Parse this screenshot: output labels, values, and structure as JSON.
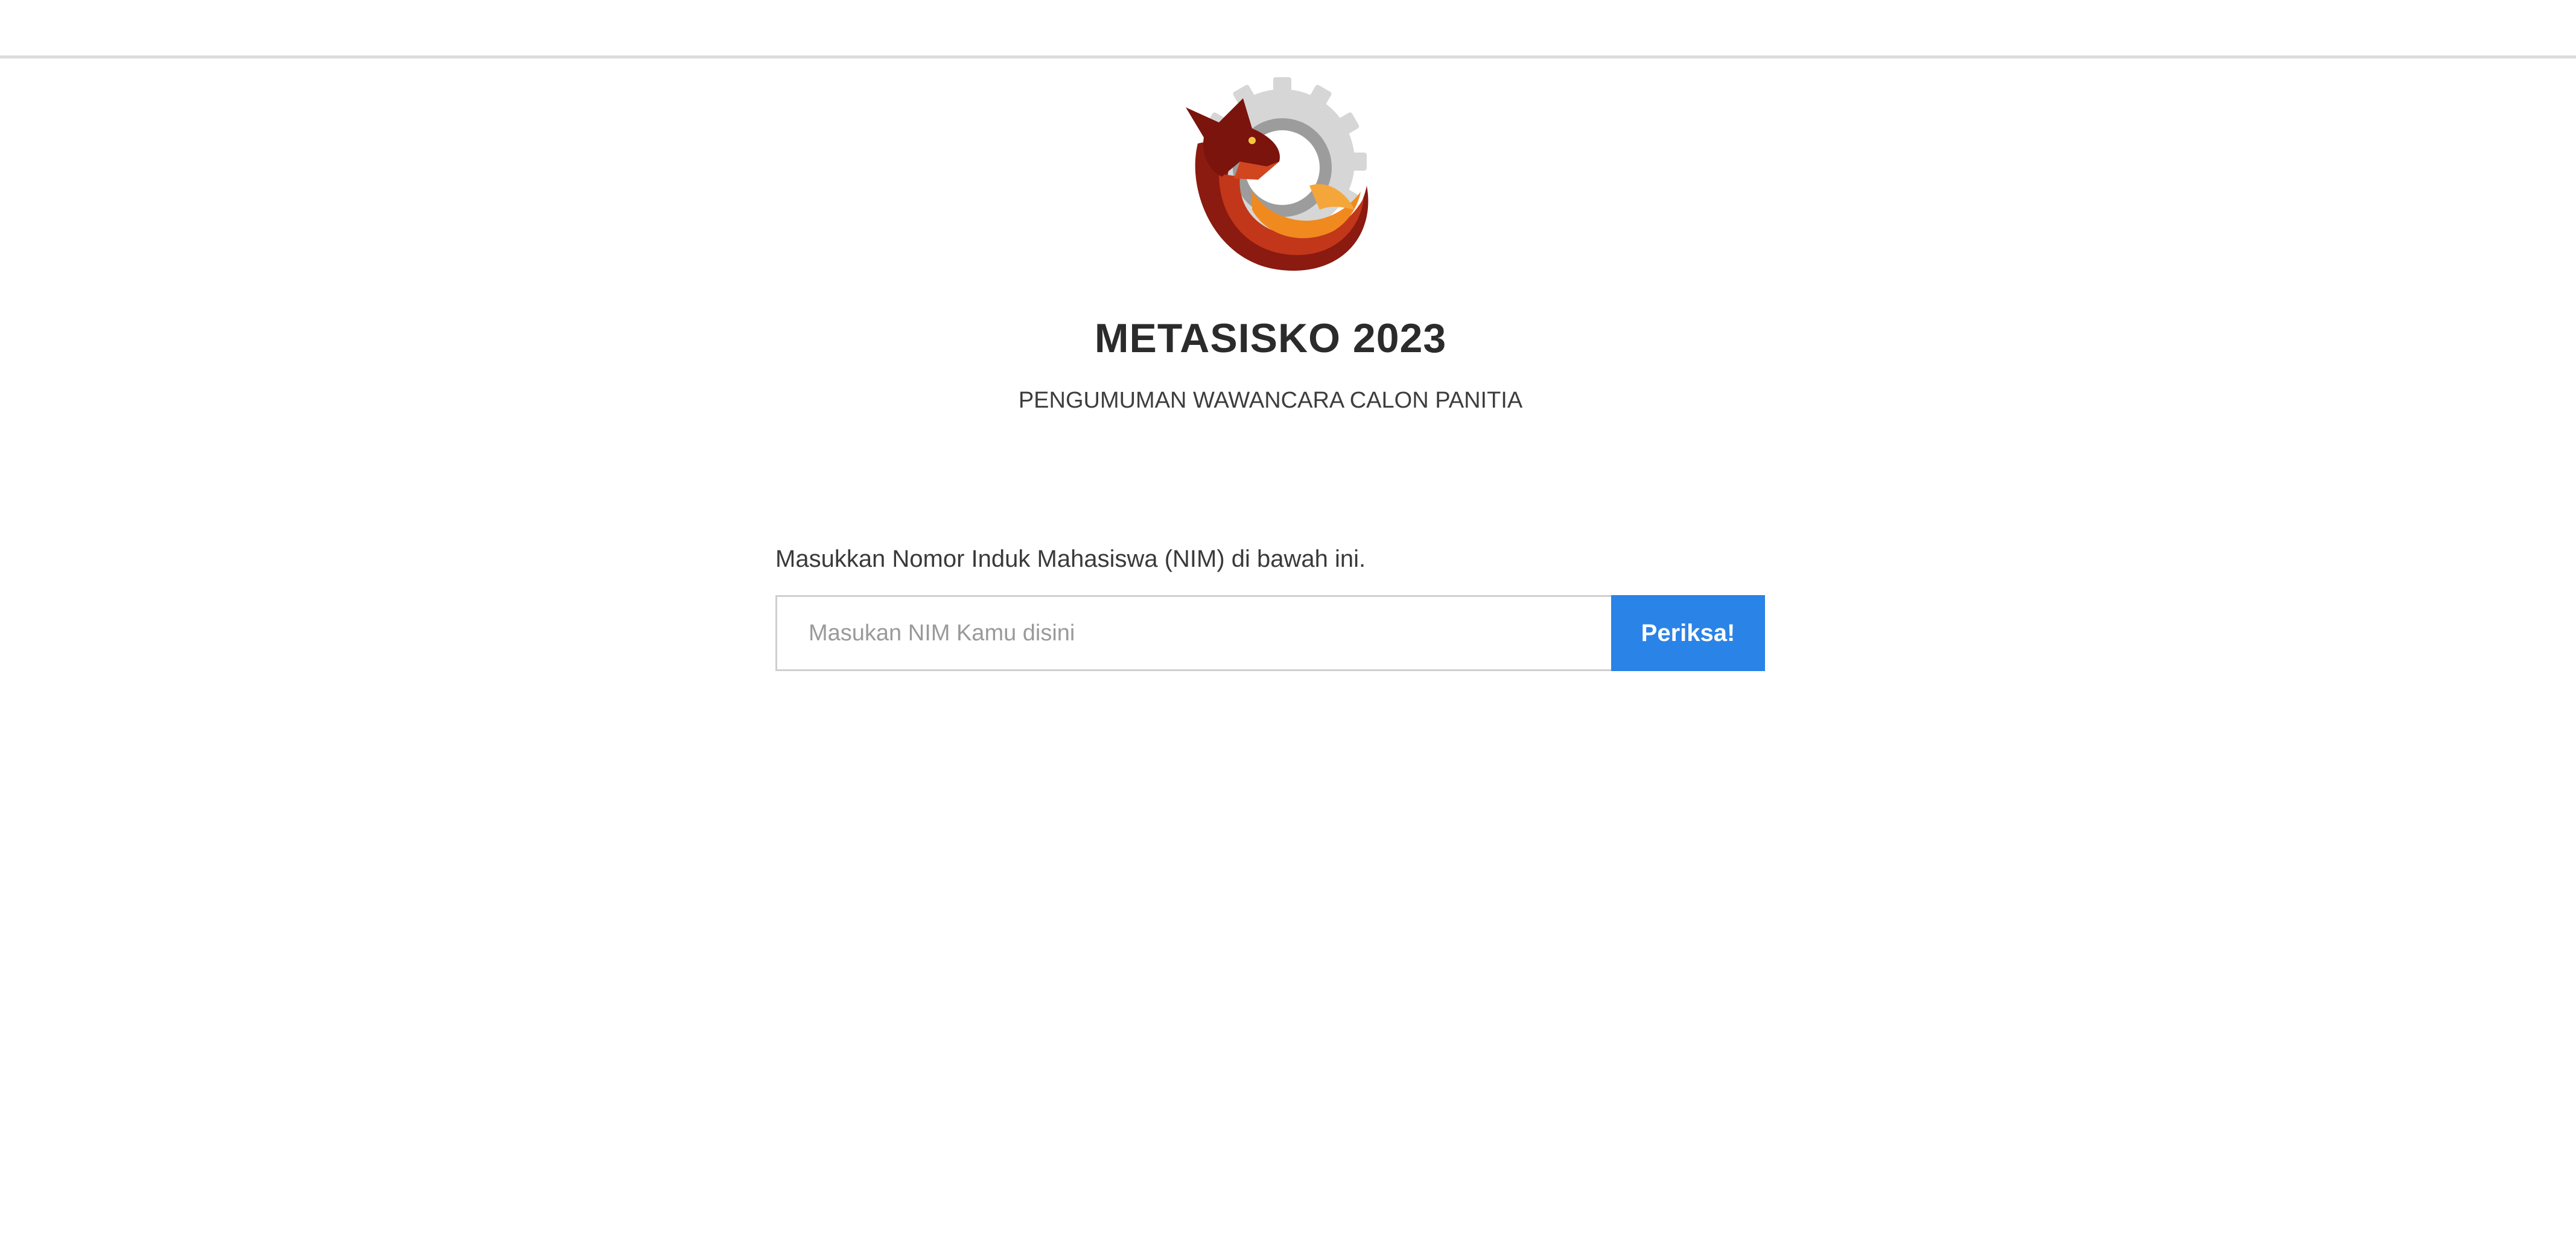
{
  "header": {
    "title": "METASISKO 2023",
    "subtitle": "PENGUMUMAN WAWANCARA CALON PANITIA"
  },
  "logo": {
    "icon": "fox-gear-logo-icon",
    "colors": {
      "gear": "#d9d9d9",
      "fox_dark": "#8b1a10",
      "fox_mid": "#c2361a",
      "fox_light": "#f08a1e"
    }
  },
  "form": {
    "instruction": "Masukkan Nomor Induk Mahasiswa (NIM) di bawah ini.",
    "nim_value": "",
    "nim_placeholder": "Masukan NIM Kamu disini",
    "submit_label": "Periksa!"
  },
  "colors": {
    "accent": "#2a83e6",
    "divider": "#dcdcdc",
    "text": "#2b2b2b"
  }
}
